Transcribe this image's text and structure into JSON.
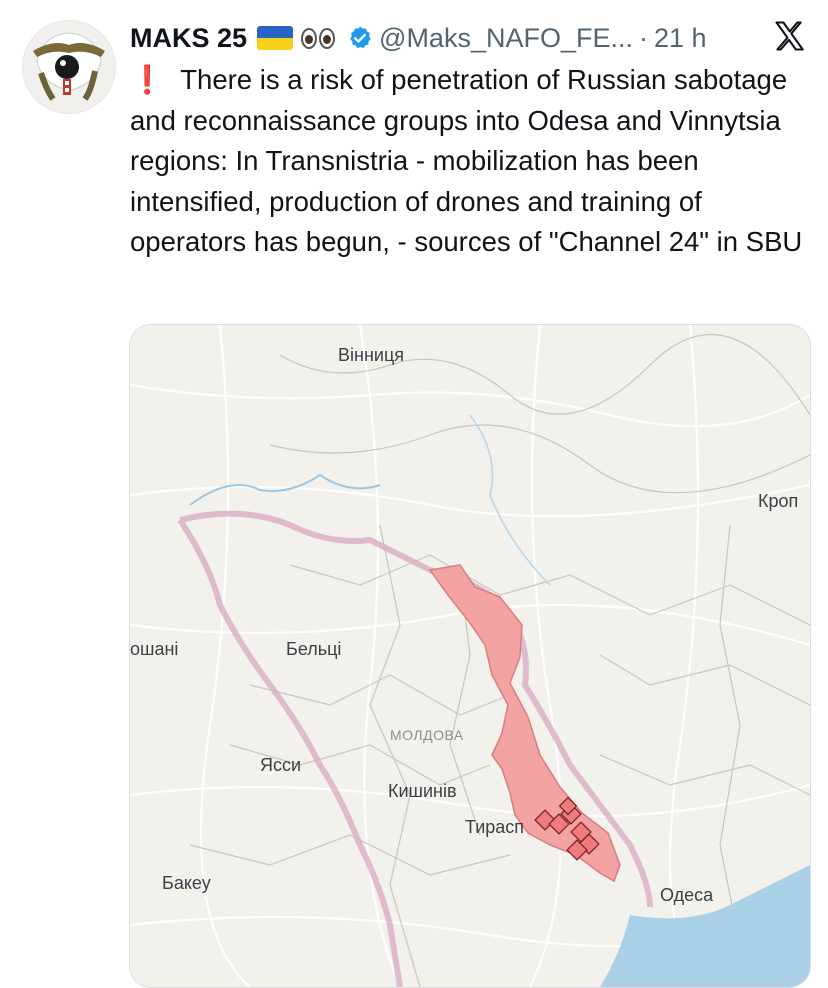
{
  "user": {
    "name": "MAKS 25",
    "handle": "@Maks_NAFO_FE...",
    "separator": "·",
    "time": "21 h"
  },
  "icons": {
    "flag": "ukraine-flag-icon",
    "eyes": "eyes-emoji-icon",
    "verified": "verified-badge-icon",
    "platform": "x-logo-icon",
    "exclamation": "red-exclamation-icon"
  },
  "tweet": {
    "exclamation": "❗",
    "text": "There is a risk of penetration of Russian sabotage and reconnaissance groups into Odesa and Vinnytsia regions: In Transnistria - mobilization has been intensified, production of drones and training of operators has begun, - sources of \"Channel 24\" in SBU"
  },
  "map": {
    "labels": {
      "vinnytsia": "Вінниця",
      "kropyvnytskyi": "Кроп",
      "botosani": "ошані",
      "balti": "Бельці",
      "moldova": "МОЛДОВА",
      "iasi": "Ясси",
      "chisinau": "Кишинів",
      "tiraspol": "Тирасп",
      "bacau": "Бакеу",
      "odesa": "Одеса"
    },
    "colors": {
      "land": "#f3f1ec",
      "transnistria": "#f4a3a3",
      "border": "#d9a7c0",
      "sea": "#a9d0e6",
      "grid": "#ffffff"
    }
  }
}
